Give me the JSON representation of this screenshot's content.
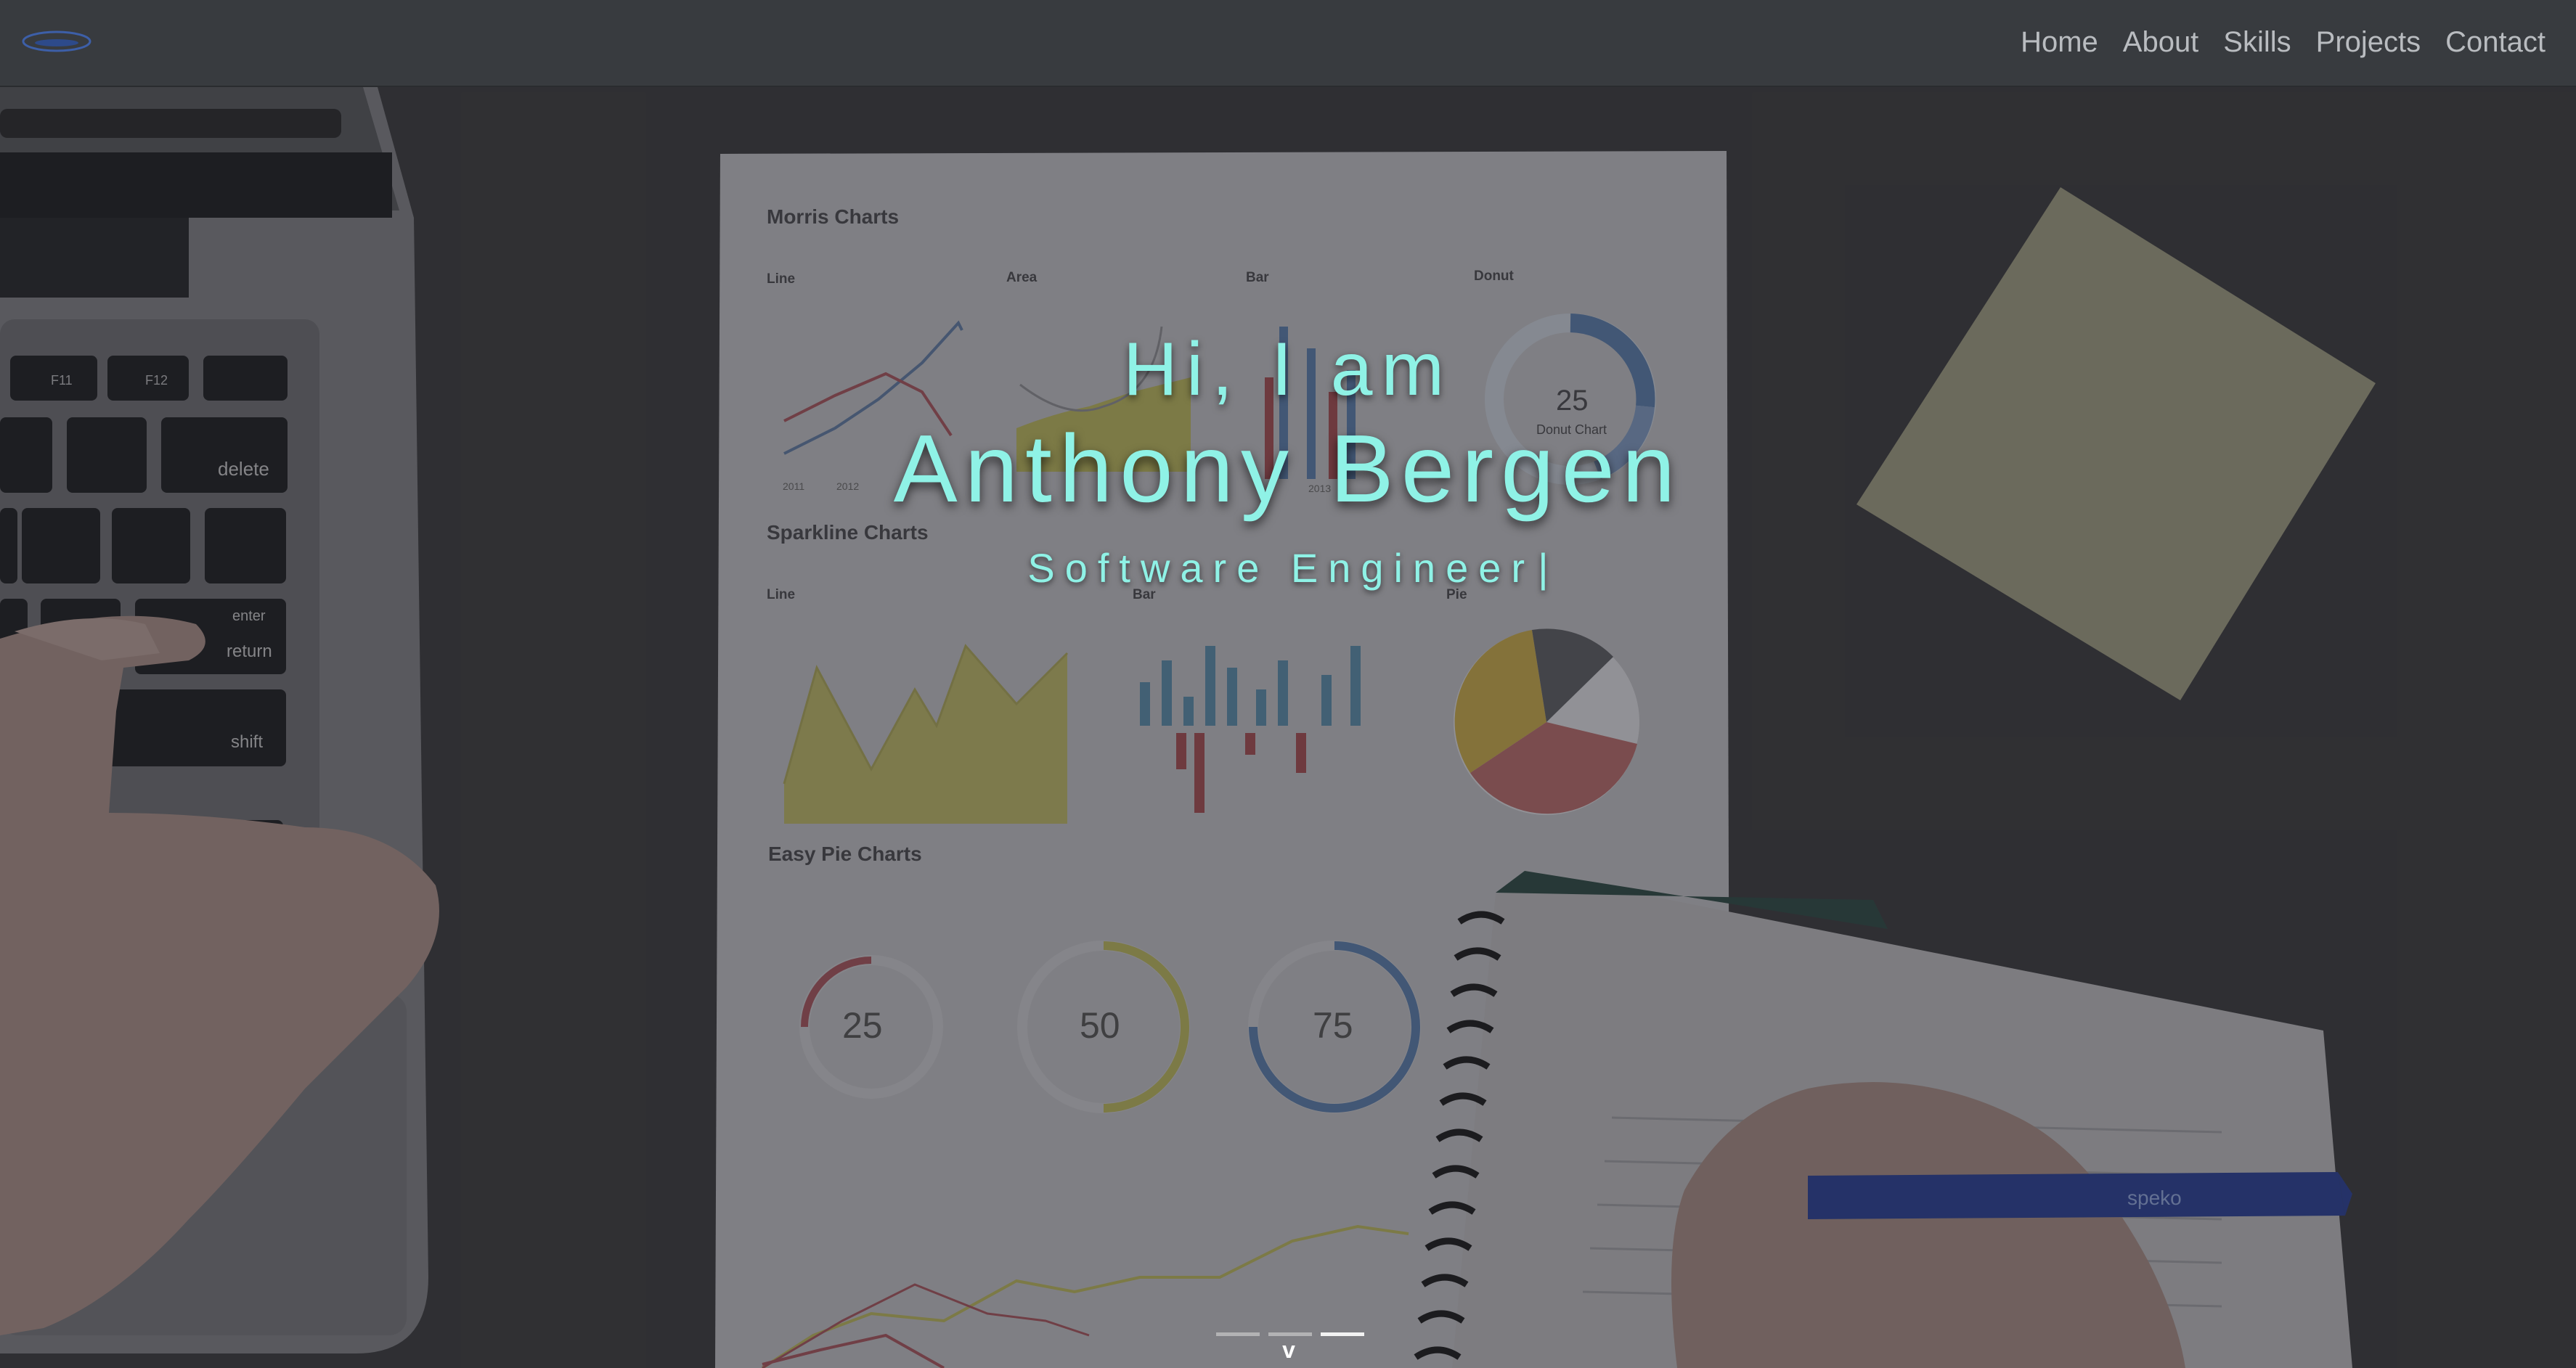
{
  "nav": {
    "logo_icon": "oval-logo",
    "links": [
      "Home",
      "About",
      "Skills",
      "Projects",
      "Contact"
    ]
  },
  "hero": {
    "greeting": "Hi, I am",
    "name": "Anthony Bergen",
    "role": "Software Engineer",
    "caret": "|",
    "slides_total": 3,
    "active_slide": 3,
    "scroll_icon": "chevron-down-icon",
    "scroll_glyph": "v",
    "text_color": "#8ff2e6"
  },
  "background": {
    "sheet_title": "Morris Charts",
    "line_chart_label": "Line",
    "area_chart_label": "Area",
    "bar_chart_label": "Bar",
    "donut_chart_label": "Donut",
    "chart_suffix": "Chart",
    "donut_value": "25",
    "donut_caption": "Donut Chart",
    "sparkline_title": "Sparkline Charts",
    "sparkline_line_label": "Line",
    "sparkline_bar_label": "Bar",
    "sparkline_pie_label": "Pie",
    "easy_pie_title": "Easy Pie Charts",
    "pie_values": [
      "25",
      "50",
      "75"
    ],
    "percent": "%",
    "pen_brand": "speko",
    "key_delete": "delete",
    "key_enter": "enter",
    "key_return": "return",
    "key_shift": "shift",
    "key_f11": "F11",
    "key_f12": "F12",
    "years": [
      "2011",
      "2012",
      "2013"
    ]
  }
}
